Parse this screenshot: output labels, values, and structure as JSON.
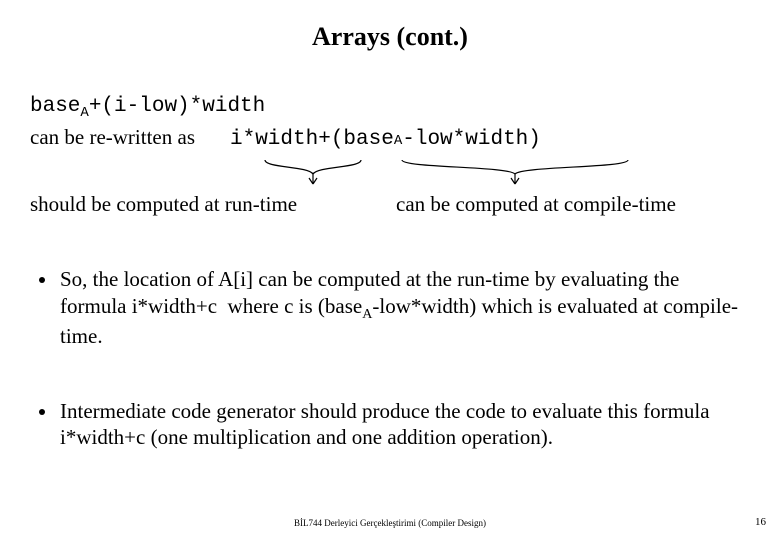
{
  "title": "Arrays (cont.)",
  "formula": {
    "line1_pre": "base",
    "line1_sub": "A",
    "line1_post": "+(i-low)*width",
    "rewrite_label": "can be re-written as",
    "expr_left": "i*width",
    "expr_plus": " + ",
    "expr_right_pre": "(base",
    "expr_right_sub": "A",
    "expr_right_post": "-low*width)"
  },
  "captions": {
    "runtime": "should be computed at run-time",
    "compiletime": "can be computed at compile-time"
  },
  "bullets": [
    "So, the location of A[i] can be computed at the run-time by evaluating the formula i*width+c  where c is (baseA-low*width) which is evaluated at compile-time.",
    "Intermediate code generator should produce the code to evaluate this formula i*width+c  (one multiplication and one addition operation)."
  ],
  "footer": "BİL744 Derleyici Gerçekleştirimi (Compiler Design)",
  "page": "16"
}
